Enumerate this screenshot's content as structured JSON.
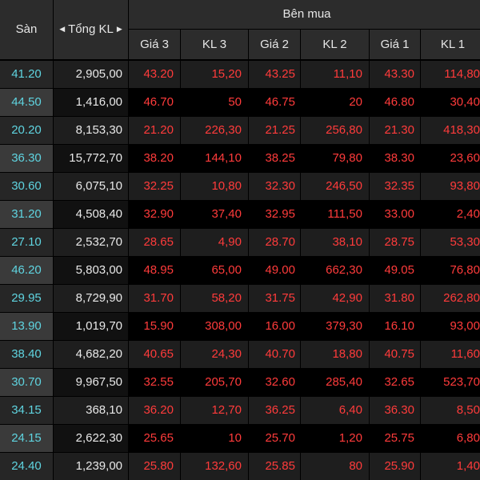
{
  "header": {
    "san": "Sàn",
    "tong_kl": "Tổng KL",
    "ben_mua": "Bên mua",
    "columns": [
      "Giá 3",
      "KL 3",
      "Giá 2",
      "KL 2",
      "Giá 1",
      "KL 1"
    ]
  },
  "rows": [
    {
      "san": "41.20",
      "tong_kl": "2,905,00",
      "g3": "43.20",
      "k3": "15,20",
      "g2": "43.25",
      "k2": "11,10",
      "g1": "43.30",
      "k1": "114,80"
    },
    {
      "san": "44.50",
      "tong_kl": "1,416,00",
      "g3": "46.70",
      "k3": "50",
      "g2": "46.75",
      "k2": "20",
      "g1": "46.80",
      "k1": "30,40"
    },
    {
      "san": "20.20",
      "tong_kl": "8,153,30",
      "g3": "21.20",
      "k3": "226,30",
      "g2": "21.25",
      "k2": "256,80",
      "g1": "21.30",
      "k1": "418,30"
    },
    {
      "san": "36.30",
      "tong_kl": "15,772,70",
      "g3": "38.20",
      "k3": "144,10",
      "g2": "38.25",
      "k2": "79,80",
      "g1": "38.30",
      "k1": "23,60"
    },
    {
      "san": "30.60",
      "tong_kl": "6,075,10",
      "g3": "32.25",
      "k3": "10,80",
      "g2": "32.30",
      "k2": "246,50",
      "g1": "32.35",
      "k1": "93,80"
    },
    {
      "san": "31.20",
      "tong_kl": "4,508,40",
      "g3": "32.90",
      "k3": "37,40",
      "g2": "32.95",
      "k2": "111,50",
      "g1": "33.00",
      "k1": "2,40"
    },
    {
      "san": "27.10",
      "tong_kl": "2,532,70",
      "g3": "28.65",
      "k3": "4,90",
      "g2": "28.70",
      "k2": "38,10",
      "g1": "28.75",
      "k1": "53,30"
    },
    {
      "san": "46.20",
      "tong_kl": "5,803,00",
      "g3": "48.95",
      "k3": "65,00",
      "g2": "49.00",
      "k2": "662,30",
      "g1": "49.05",
      "k1": "76,80"
    },
    {
      "san": "29.95",
      "tong_kl": "8,729,90",
      "g3": "31.70",
      "k3": "58,20",
      "g2": "31.75",
      "k2": "42,90",
      "g1": "31.80",
      "k1": "262,80"
    },
    {
      "san": "13.90",
      "tong_kl": "1,019,70",
      "g3": "15.90",
      "k3": "308,00",
      "g2": "16.00",
      "k2": "379,30",
      "g1": "16.10",
      "k1": "93,00"
    },
    {
      "san": "38.40",
      "tong_kl": "4,682,20",
      "g3": "40.65",
      "k3": "24,30",
      "g2": "40.70",
      "k2": "18,80",
      "g1": "40.75",
      "k1": "11,60"
    },
    {
      "san": "30.70",
      "tong_kl": "9,967,50",
      "g3": "32.55",
      "k3": "205,70",
      "g2": "32.60",
      "k2": "285,40",
      "g1": "32.65",
      "k1": "523,70"
    },
    {
      "san": "34.15",
      "tong_kl": "368,10",
      "g3": "36.20",
      "k3": "12,70",
      "g2": "36.25",
      "k2": "6,40",
      "g1": "36.30",
      "k1": "8,50"
    },
    {
      "san": "24.15",
      "tong_kl": "2,622,30",
      "g3": "25.65",
      "k3": "10",
      "g2": "25.70",
      "k2": "1,20",
      "g1": "25.75",
      "k1": "6,80"
    },
    {
      "san": "24.40",
      "tong_kl": "1,239,00",
      "g3": "25.80",
      "k3": "132,60",
      "g2": "25.85",
      "k2": "80",
      "g1": "25.90",
      "k1": "1,40"
    }
  ],
  "colors": {
    "floor_price": "#5fd4e0",
    "bid_values": "#ff3b3b",
    "header_bg": "#2c2c2c",
    "background": "#000000"
  },
  "icons": [
    "caret-left-icon",
    "caret-right-icon"
  ]
}
